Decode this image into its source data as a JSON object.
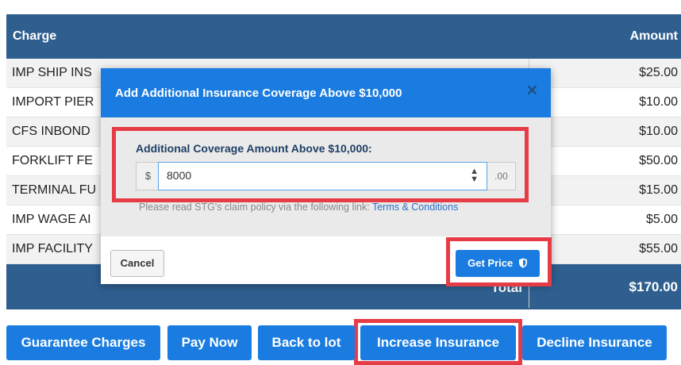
{
  "table": {
    "header": {
      "charge": "Charge",
      "amount": "Amount"
    },
    "rows": [
      {
        "charge": "IMP SHIP INS",
        "amount": "$25.00"
      },
      {
        "charge": "IMPORT PIER",
        "amount": "$10.00"
      },
      {
        "charge": "CFS INBOND",
        "amount": "$10.00"
      },
      {
        "charge": "FORKLIFT FE",
        "amount": "$50.00"
      },
      {
        "charge": "TERMINAL FU",
        "amount": "$15.00"
      },
      {
        "charge": "IMP WAGE AI",
        "amount": "$5.00"
      },
      {
        "charge": "IMP FACILITY",
        "amount": "$55.00"
      }
    ],
    "total_label": "Total",
    "total_amount": "$170.00"
  },
  "modal": {
    "title": "Add Additional Insurance Coverage Above $10,000",
    "close_glyph": "✕",
    "field_label": "Additional Coverage Amount Above $10,000:",
    "currency_prefix": "$",
    "amount_value": "8000",
    "cents_suffix": ".00",
    "note_text": "Please read STG's claim policy via the following link: ",
    "note_link": "Terms & Conditions",
    "cancel_label": "Cancel",
    "get_price_label": "Get Price",
    "shield_icon": "shield-icon"
  },
  "buttons": {
    "guarantee": "Guarantee Charges",
    "pay_now": "Pay Now",
    "back_to_lot": "Back to lot",
    "increase_insurance": "Increase Insurance",
    "decline_insurance": "Decline Insurance"
  },
  "colors": {
    "header_blue": "#2e5f8f",
    "primary_blue": "#1a7ce0",
    "highlight_red": "#e63c46"
  }
}
